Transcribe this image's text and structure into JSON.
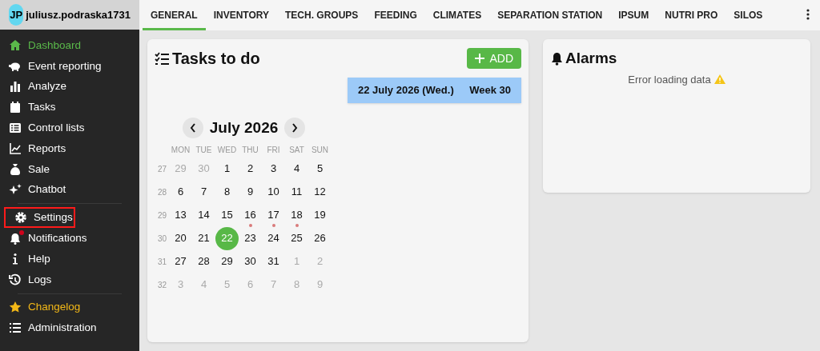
{
  "user": {
    "initials": "JP",
    "name": "juliusz.podraska1731"
  },
  "sidebar": {
    "groups": [
      [
        {
          "label": "Dashboard",
          "selected": true,
          "highlighted": false,
          "badge": false,
          "accent": false
        },
        {
          "label": "Event reporting",
          "selected": false,
          "highlighted": false,
          "badge": false,
          "accent": false
        },
        {
          "label": "Analyze",
          "selected": false,
          "highlighted": false,
          "badge": false,
          "accent": false
        },
        {
          "label": "Tasks",
          "selected": false,
          "highlighted": false,
          "badge": false,
          "accent": false
        },
        {
          "label": "Control lists",
          "selected": false,
          "highlighted": false,
          "badge": false,
          "accent": false
        },
        {
          "label": "Reports",
          "selected": false,
          "highlighted": false,
          "badge": false,
          "accent": false
        },
        {
          "label": "Sale",
          "selected": false,
          "highlighted": false,
          "badge": false,
          "accent": false
        },
        {
          "label": "Chatbot",
          "selected": false,
          "highlighted": false,
          "badge": false,
          "accent": false
        }
      ],
      [
        {
          "label": "Settings",
          "selected": false,
          "highlighted": true,
          "badge": false,
          "accent": false
        },
        {
          "label": "Notifications",
          "selected": false,
          "highlighted": false,
          "badge": true,
          "accent": false
        },
        {
          "label": "Help",
          "selected": false,
          "highlighted": false,
          "badge": false,
          "accent": false
        },
        {
          "label": "Logs",
          "selected": false,
          "highlighted": false,
          "badge": false,
          "accent": false
        }
      ],
      [
        {
          "label": "Changelog",
          "selected": false,
          "highlighted": false,
          "badge": false,
          "accent": true
        },
        {
          "label": "Administration",
          "selected": false,
          "highlighted": false,
          "badge": false,
          "accent": false
        }
      ]
    ]
  },
  "tabs": [
    {
      "label": "GENERAL",
      "selected": true
    },
    {
      "label": "INVENTORY",
      "selected": false
    },
    {
      "label": "TECH. GROUPS",
      "selected": false
    },
    {
      "label": "FEEDING",
      "selected": false
    },
    {
      "label": "CLIMATES",
      "selected": false
    },
    {
      "label": "SEPARATION STATION",
      "selected": false
    },
    {
      "label": "IPSUM",
      "selected": false
    },
    {
      "label": "NUTRI PRO",
      "selected": false
    },
    {
      "label": "SILOS",
      "selected": false
    }
  ],
  "tasks": {
    "title": "Tasks to do",
    "add_button": "ADD",
    "date": "22 July 2026 (Wed.)",
    "week": "Week 30",
    "calendar": {
      "month": "July 2026",
      "weekdays": [
        "MON",
        "TUE",
        "WED",
        "THU",
        "FRI",
        "SAT",
        "SUN"
      ],
      "weeks": [
        {
          "number": "27",
          "days": [
            {
              "day": "29",
              "outside": true,
              "selected": false,
              "event": false
            },
            {
              "day": "30",
              "outside": true,
              "selected": false,
              "event": false
            },
            {
              "day": "1",
              "outside": false,
              "selected": false,
              "event": false
            },
            {
              "day": "2",
              "outside": false,
              "selected": false,
              "event": false
            },
            {
              "day": "3",
              "outside": false,
              "selected": false,
              "event": false
            },
            {
              "day": "4",
              "outside": false,
              "selected": false,
              "event": false
            },
            {
              "day": "5",
              "outside": false,
              "selected": false,
              "event": false
            }
          ]
        },
        {
          "number": "28",
          "days": [
            {
              "day": "6",
              "outside": false,
              "selected": false,
              "event": false
            },
            {
              "day": "7",
              "outside": false,
              "selected": false,
              "event": false
            },
            {
              "day": "8",
              "outside": false,
              "selected": false,
              "event": false
            },
            {
              "day": "9",
              "outside": false,
              "selected": false,
              "event": false
            },
            {
              "day": "10",
              "outside": false,
              "selected": false,
              "event": false
            },
            {
              "day": "11",
              "outside": false,
              "selected": false,
              "event": false
            },
            {
              "day": "12",
              "outside": false,
              "selected": false,
              "event": false
            }
          ]
        },
        {
          "number": "29",
          "days": [
            {
              "day": "13",
              "outside": false,
              "selected": false,
              "event": false
            },
            {
              "day": "14",
              "outside": false,
              "selected": false,
              "event": false
            },
            {
              "day": "15",
              "outside": false,
              "selected": false,
              "event": false
            },
            {
              "day": "16",
              "outside": false,
              "selected": false,
              "event": true
            },
            {
              "day": "17",
              "outside": false,
              "selected": false,
              "event": true
            },
            {
              "day": "18",
              "outside": false,
              "selected": false,
              "event": true
            },
            {
              "day": "19",
              "outside": false,
              "selected": false,
              "event": false
            }
          ]
        },
        {
          "number": "30",
          "days": [
            {
              "day": "20",
              "outside": false,
              "selected": false,
              "event": false
            },
            {
              "day": "21",
              "outside": false,
              "selected": false,
              "event": false
            },
            {
              "day": "22",
              "outside": false,
              "selected": true,
              "event": false
            },
            {
              "day": "23",
              "outside": false,
              "selected": false,
              "event": false
            },
            {
              "day": "24",
              "outside": false,
              "selected": false,
              "event": false
            },
            {
              "day": "25",
              "outside": false,
              "selected": false,
              "event": false
            },
            {
              "day": "26",
              "outside": false,
              "selected": false,
              "event": false
            }
          ]
        },
        {
          "number": "31",
          "days": [
            {
              "day": "27",
              "outside": false,
              "selected": false,
              "event": false
            },
            {
              "day": "28",
              "outside": false,
              "selected": false,
              "event": false
            },
            {
              "day": "29",
              "outside": false,
              "selected": false,
              "event": false
            },
            {
              "day": "30",
              "outside": false,
              "selected": false,
              "event": false
            },
            {
              "day": "31",
              "outside": false,
              "selected": false,
              "event": false
            },
            {
              "day": "1",
              "outside": true,
              "selected": false,
              "event": false
            },
            {
              "day": "2",
              "outside": true,
              "selected": false,
              "event": false
            }
          ]
        },
        {
          "number": "32",
          "days": [
            {
              "day": "3",
              "outside": true,
              "selected": false,
              "event": false
            },
            {
              "day": "4",
              "outside": true,
              "selected": false,
              "event": false
            },
            {
              "day": "5",
              "outside": true,
              "selected": false,
              "event": false
            },
            {
              "day": "6",
              "outside": true,
              "selected": false,
              "event": false
            },
            {
              "day": "7",
              "outside": true,
              "selected": false,
              "event": false
            },
            {
              "day": "8",
              "outside": true,
              "selected": false,
              "event": false
            },
            {
              "day": "9",
              "outside": true,
              "selected": false,
              "event": false
            }
          ]
        }
      ]
    }
  },
  "alarms": {
    "title": "Alarms",
    "message": "Error loading data"
  }
}
